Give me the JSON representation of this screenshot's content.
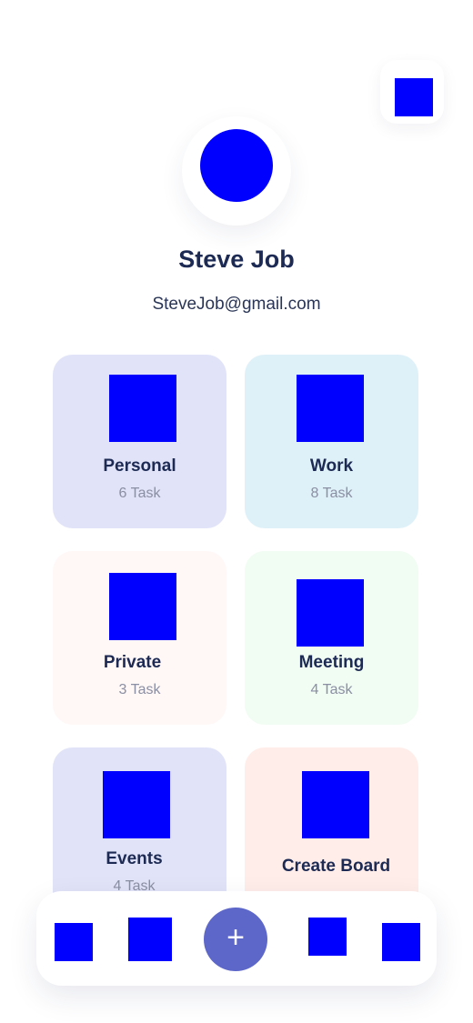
{
  "profile": {
    "name": "Steve Job",
    "email": "SteveJob@gmail.com"
  },
  "boards": [
    {
      "title": "Personal",
      "count": "6 Task",
      "bg": "#e1e3f8"
    },
    {
      "title": "Work",
      "count": "8 Task",
      "bg": "#dff1f8"
    },
    {
      "title": "Private",
      "count": "3 Task",
      "bg": "#fff8f7"
    },
    {
      "title": "Meeting",
      "count": "4 Task",
      "bg": "#f1fcf3"
    },
    {
      "title": "Events",
      "count": "4 Task",
      "bg": "#e1e3f8"
    },
    {
      "title": "Create Board",
      "bg": "#ffede9"
    }
  ],
  "nav": {
    "add_label": "+",
    "accent": "#5d66c9"
  },
  "placeholder_color": "#0000ff"
}
